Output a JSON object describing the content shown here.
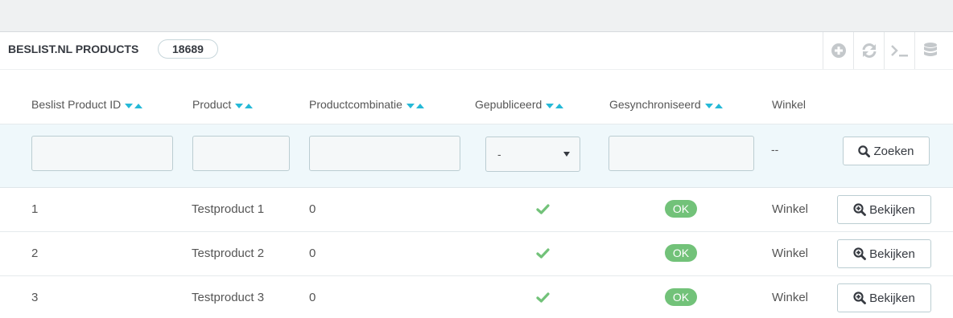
{
  "panel": {
    "title": "BESLIST.NL PRODUCTS",
    "count": "18689"
  },
  "toolbar": {
    "icons": [
      "add-icon",
      "refresh-icon",
      "terminal-icon",
      "database-icon"
    ]
  },
  "table": {
    "columns": [
      {
        "label": "Beslist Product ID",
        "sortable": true
      },
      {
        "label": "Product",
        "sortable": true
      },
      {
        "label": "Productcombinatie",
        "sortable": true
      },
      {
        "label": "Gepubliceerd",
        "sortable": true
      },
      {
        "label": "Gesynchroniseerd",
        "sortable": true
      },
      {
        "label": "Winkel",
        "sortable": false
      }
    ],
    "filters": {
      "published_selected": "-",
      "winkel_placeholder": "--",
      "search_label": "Zoeken"
    },
    "rows": [
      {
        "id": "1",
        "product": "Testproduct 1",
        "combination": "0",
        "published": true,
        "synced": "OK",
        "shop": "Winkel",
        "action": "Bekijken"
      },
      {
        "id": "2",
        "product": "Testproduct 2",
        "combination": "0",
        "published": true,
        "synced": "OK",
        "shop": "Winkel",
        "action": "Bekijken"
      },
      {
        "id": "3",
        "product": "Testproduct 3",
        "combination": "0",
        "published": true,
        "synced": "OK",
        "shop": "Winkel",
        "action": "Bekijken"
      }
    ]
  },
  "colors": {
    "accent": "#25b9d7",
    "success": "#72c279",
    "filter_bg": "#eff8fb"
  }
}
